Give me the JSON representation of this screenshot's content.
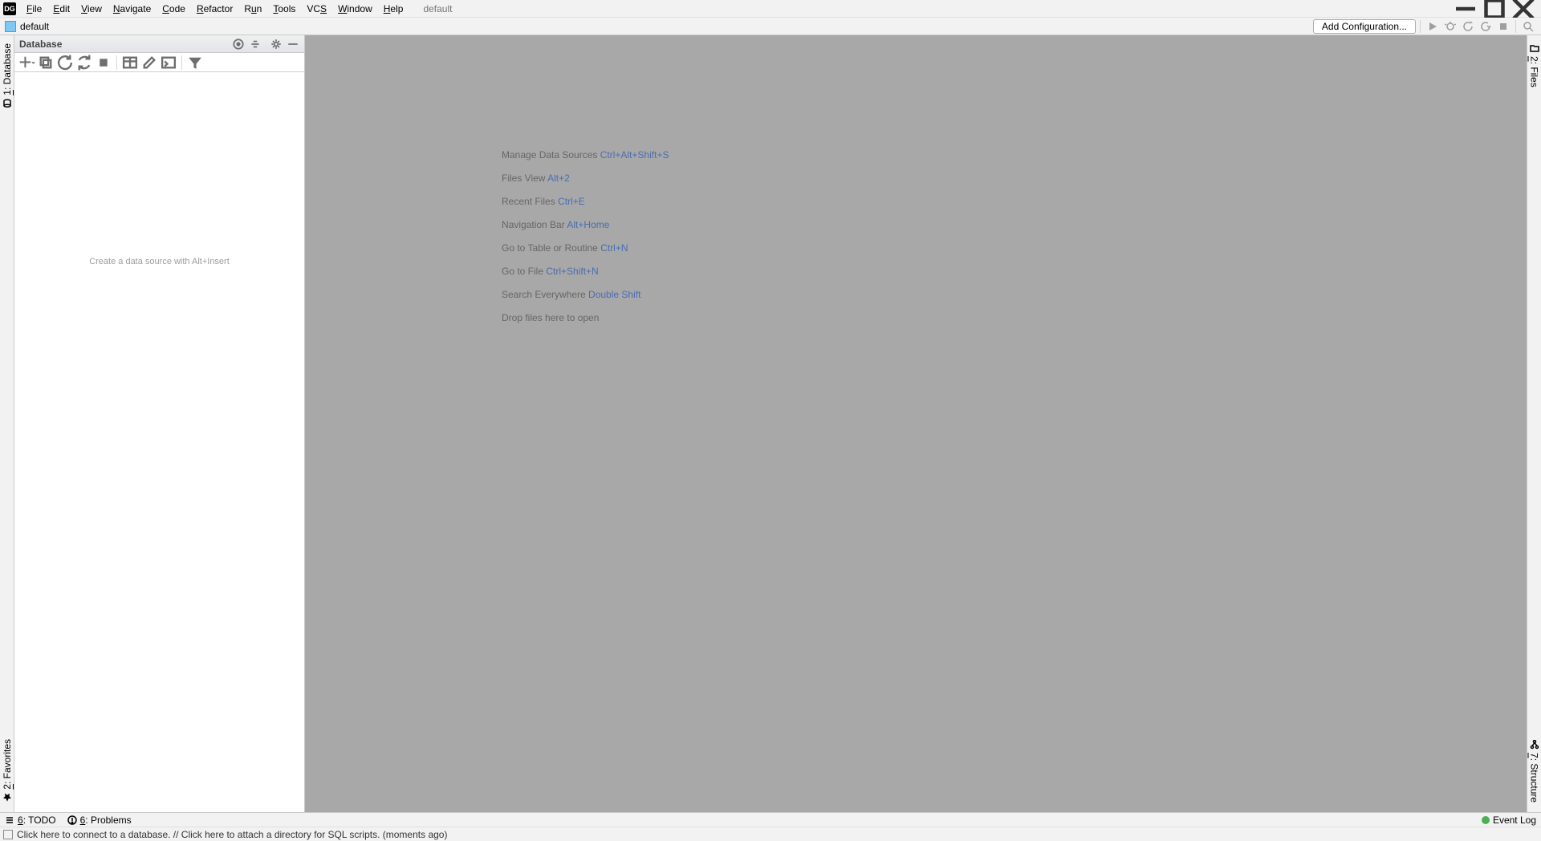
{
  "window": {
    "title": "default"
  },
  "menu": {
    "file": "File",
    "edit": "Edit",
    "view": "View",
    "navigate": "Navigate",
    "code": "Code",
    "refactor": "Refactor",
    "run": "Run",
    "tools": "Tools",
    "vcs": "VCS",
    "window": "Window",
    "help": "Help"
  },
  "navbar": {
    "project": "default",
    "add_config": "Add Configuration..."
  },
  "left_gutter": {
    "database": "Database",
    "database_num": "1",
    "favorites": "Favorites",
    "favorites_num": "2"
  },
  "right_gutter": {
    "files": "Files",
    "files_num": "2",
    "structure": "Structure",
    "structure_num": "7"
  },
  "db_panel": {
    "title": "Database",
    "placeholder": "Create a data source with Alt+Insert"
  },
  "hints": [
    {
      "label": "Manage Data Sources ",
      "shortcut": "Ctrl+Alt+Shift+S"
    },
    {
      "label": "Files View ",
      "shortcut": "Alt+2"
    },
    {
      "label": "Recent Files ",
      "shortcut": "Ctrl+E"
    },
    {
      "label": "Navigation Bar ",
      "shortcut": "Alt+Home"
    },
    {
      "label": "Go to Table or Routine ",
      "shortcut": "Ctrl+N"
    },
    {
      "label": "Go to File ",
      "shortcut": "Ctrl+Shift+N"
    },
    {
      "label": "Search Everywhere ",
      "shortcut": "Double Shift"
    },
    {
      "label": "Drop files here to open",
      "shortcut": ""
    }
  ],
  "bottom": {
    "todo": "TODO",
    "todo_num": "6",
    "problems": "Problems",
    "problems_num": "6",
    "event_log": "Event Log"
  },
  "status": {
    "message": "Click here to connect to a database. // Click here to attach a directory for SQL scripts. (moments ago)"
  }
}
